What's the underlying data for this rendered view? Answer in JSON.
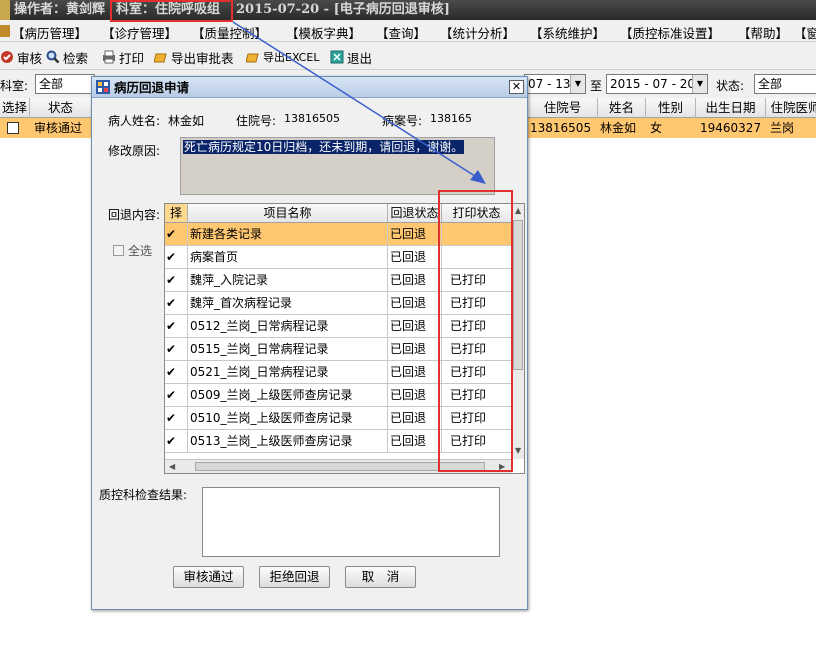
{
  "app": {
    "title_segments": [
      "操作者：黄剑辉",
      "科室：住院呼吸组",
      "2015-07-20 - [电子病历回退审核]"
    ],
    "menu": [
      "【病历管理】",
      "【诊疗管理】",
      "【质量控制】",
      "【模板字典】",
      "【查询】",
      "【统计分析】",
      "【系统维护】",
      "【质控标准设置】",
      "【帮助】",
      "【窗"
    ],
    "toolbar": [
      "审核",
      "检索",
      "打印",
      "导出审批表",
      "导出EXCEL",
      "退出"
    ],
    "filter": {
      "dept_label": "科室:",
      "dept_value": "全部",
      "date_from": "07 - 13",
      "to_label": "至",
      "date_to": "2015 - 07 - 20",
      "status_label": "状态:",
      "status_value": "全部"
    },
    "grid": {
      "headers": [
        "选择",
        "状态",
        "住院号",
        "姓名",
        "性别",
        "出生日期",
        "住院医师"
      ],
      "row": {
        "status": "审核通过",
        "inpatient_no": "13816505",
        "name": "林金如",
        "gender": "女",
        "birth_date": "19460327",
        "doctor": "兰岗"
      }
    }
  },
  "dialog": {
    "title": "病历回退申请",
    "patient_name_label": "病人姓名:",
    "patient_name": "林金如",
    "inpatient_no_label": "住院号:",
    "inpatient_no": "13816505",
    "case_no_label": "病案号:",
    "case_no": "138165",
    "reason_label": "修改原因:",
    "reason_text": "死亡病历规定10日归档，还未到期，请回退，谢谢。",
    "content_label": "回退内容:",
    "select_all_label": "全选",
    "table": {
      "headers": [
        "择",
        "项目名称",
        "回退状态",
        "打印状态"
      ],
      "rows": [
        {
          "checked": true,
          "name": "新建各类记录",
          "rollback": "已回退",
          "print": ""
        },
        {
          "checked": true,
          "name": "病案首页",
          "rollback": "已回退",
          "print": ""
        },
        {
          "checked": true,
          "name": "魏萍_入院记录",
          "rollback": "已回退",
          "print": "已打印"
        },
        {
          "checked": true,
          "name": "魏萍_首次病程记录",
          "rollback": "已回退",
          "print": "已打印"
        },
        {
          "checked": true,
          "name": "0512_兰岗_日常病程记录",
          "rollback": "已回退",
          "print": "已打印"
        },
        {
          "checked": true,
          "name": "0515_兰岗_日常病程记录",
          "rollback": "已回退",
          "print": "已打印"
        },
        {
          "checked": true,
          "name": "0521_兰岗_日常病程记录",
          "rollback": "已回退",
          "print": "已打印"
        },
        {
          "checked": true,
          "name": "0509_兰岗_上级医师查房记录",
          "rollback": "已回退",
          "print": "已打印"
        },
        {
          "checked": true,
          "name": "0510_兰岗_上级医师查房记录",
          "rollback": "已回退",
          "print": "已打印"
        },
        {
          "checked": true,
          "name": "0513_兰岗_上级医师查房记录",
          "rollback": "已回退",
          "print": "已打印"
        }
      ]
    },
    "qc_result_label": "质控科检查结果:",
    "buttons": {
      "approve": "审核通过",
      "reject": "拒绝回退",
      "cancel": "取　消"
    }
  },
  "colors": {
    "selected_row": "#ffc870",
    "annotation_red": "#e03030",
    "annotation_arrow": "#3a5fcd",
    "reason_highlight": "#0a246a"
  }
}
